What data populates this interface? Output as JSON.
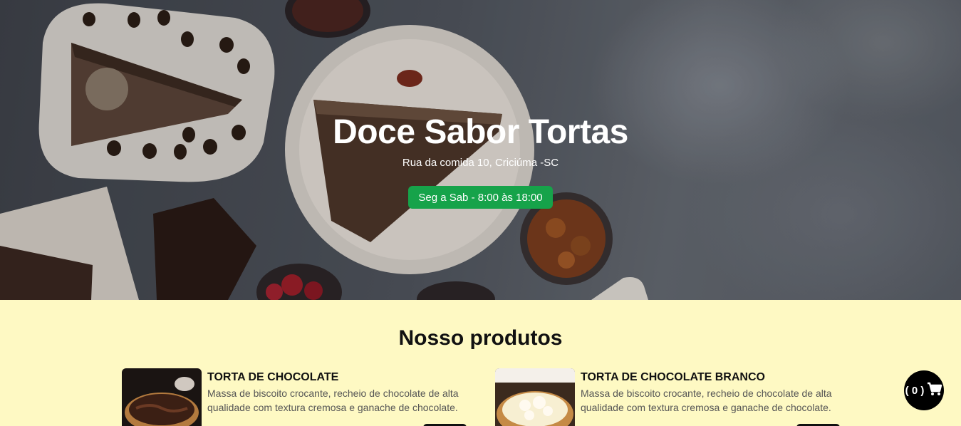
{
  "hero": {
    "title": "Doce Sabor Tortas",
    "address": "Rua da comida 10, Criciúma -SC",
    "hours": "Seg a Sab - 8:00 às 18:00"
  },
  "products": {
    "heading": "Nosso produtos",
    "items": [
      {
        "name": "TORTA DE CHOCOLATE",
        "description": "Massa de biscoito crocante, recheio de chocolate de alta qualidade com textura cremosa e ganache de chocolate."
      },
      {
        "name": "TORTA DE CHOCOLATE BRANCO",
        "description": "Massa de biscoito crocante, recheio de chocolate de alta qualidade com textura cremosa e ganache de chocolate."
      }
    ]
  },
  "cart": {
    "count_label": "( 0 )",
    "icon": "cart-icon"
  },
  "colors": {
    "accent_green": "#16a34a",
    "page_bg": "#fef9c3",
    "cart_bg": "#000000"
  }
}
